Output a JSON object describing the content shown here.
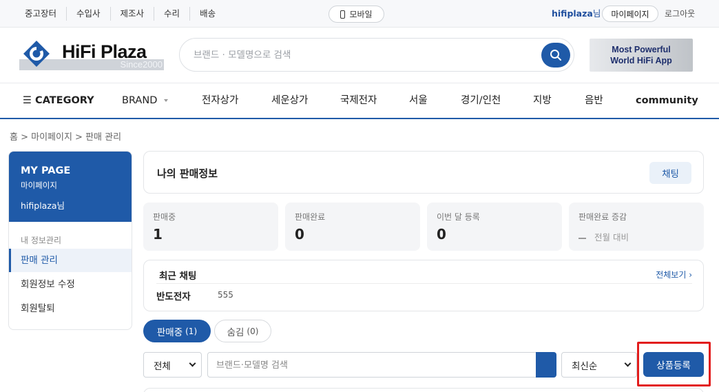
{
  "topbar": {
    "links": [
      "중고장터",
      "수입사",
      "제조사",
      "수리",
      "배송"
    ],
    "mobile_label": "모바일",
    "user_name": "hifiplaza",
    "user_suffix": "님",
    "mypage_label": "마이페이지",
    "logout_label": "로그아웃"
  },
  "header": {
    "logo_text": "HiFi Plaza",
    "logo_since": "Since2000",
    "search_placeholder": "브랜드 · 모델명으로 검색",
    "banner_line1": "Most Powerful",
    "banner_line2": "World HiFi App"
  },
  "nav": {
    "category": "☰ CATEGORY",
    "brand": "BRAND",
    "items": [
      "전자상가",
      "세운상가",
      "국제전자",
      "서울",
      "경기/인천",
      "지방",
      "음반",
      "community"
    ]
  },
  "breadcrumb": "홈 > 마이페이지 > 판매 관리",
  "sidebar": {
    "title": "MY PAGE",
    "subtitle": "마이페이지",
    "user": "hifiplaza님",
    "section": "내 정보관리",
    "items": [
      "판매 관리",
      "회원정보 수정",
      "회원탈퇴"
    ]
  },
  "main": {
    "info_title": "나의 판매정보",
    "chat_button": "채팅",
    "stats": [
      {
        "label": "판매중",
        "value": "1"
      },
      {
        "label": "판매완료",
        "value": "0"
      },
      {
        "label": "이번 달 등록",
        "value": "0"
      },
      {
        "label": "판매완료 증감",
        "value": "전월 대비"
      }
    ],
    "recent_chat": {
      "title": "최근 채팅",
      "more": "전체보기 ›",
      "name": "반도전자",
      "message": "555"
    },
    "tabs": [
      {
        "label": "판매중",
        "count": "(1)"
      },
      {
        "label": "숨김",
        "count": "(0)"
      }
    ],
    "filter_value": "전체",
    "search_placeholder": "브랜드·모델명 검색",
    "sort_value": "최신순",
    "register_button": "상품등록"
  },
  "colors": {
    "brand_blue": "#1f5aa8",
    "highlight_red": "#e21c1c"
  }
}
